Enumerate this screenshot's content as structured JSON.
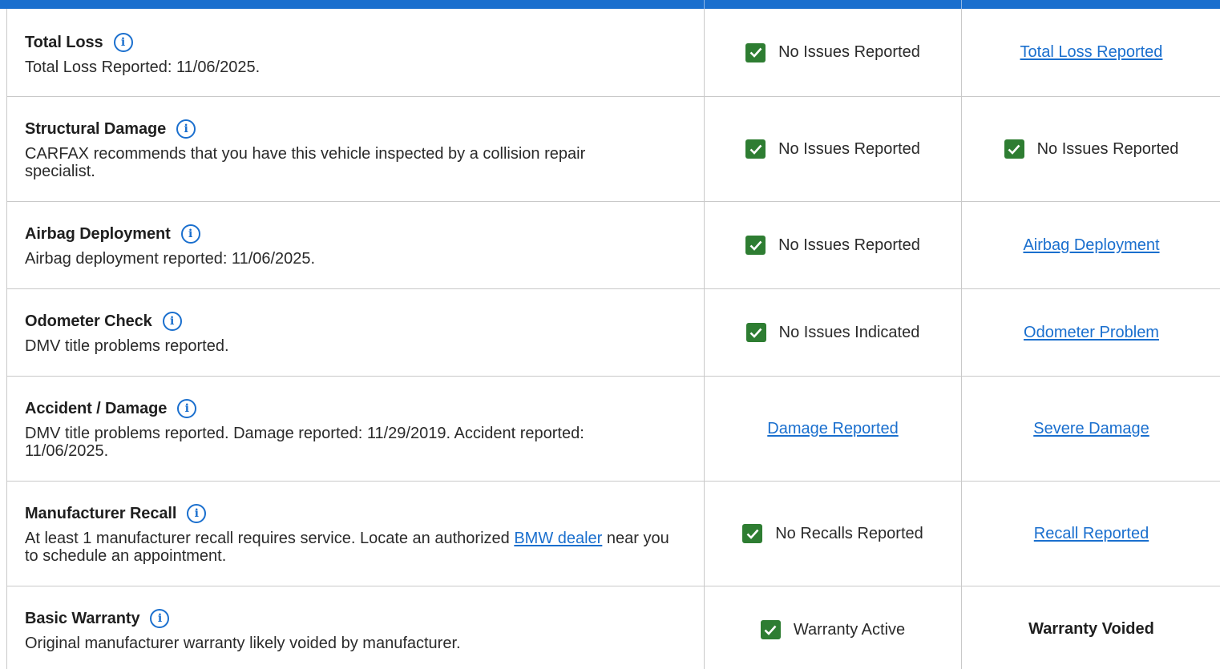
{
  "header": {
    "bar_color": "#1a6fce"
  },
  "rows": [
    {
      "title": "Total Loss",
      "desc": "Total Loss Reported: 11/06/2025.",
      "col2": {
        "kind": "check",
        "text": "No Issues Reported"
      },
      "col3": {
        "kind": "link",
        "text": "Total Loss Reported"
      }
    },
    {
      "title": "Structural Damage",
      "desc": "CARFAX recommends that you have this vehicle inspected by a collision repair specialist.",
      "col2": {
        "kind": "check",
        "text": "No Issues Reported"
      },
      "col3": {
        "kind": "check",
        "text": "No Issues Reported"
      }
    },
    {
      "title": "Airbag Deployment",
      "desc": "Airbag deployment reported: 11/06/2025.",
      "col2": {
        "kind": "check",
        "text": "No Issues Reported"
      },
      "col3": {
        "kind": "link",
        "text": "Airbag Deployment"
      }
    },
    {
      "title": "Odometer Check",
      "desc": "DMV title problems reported.",
      "col2": {
        "kind": "check",
        "text": "No Issues Indicated"
      },
      "col3": {
        "kind": "link",
        "text": "Odometer Problem"
      }
    },
    {
      "title": "Accident / Damage",
      "desc": "DMV title problems reported. Damage reported: 11/29/2019. Accident reported: 11/06/2025.",
      "col2": {
        "kind": "link",
        "text": "Damage Reported"
      },
      "col3": {
        "kind": "link",
        "text": "Severe Damage"
      }
    },
    {
      "title": "Manufacturer Recall",
      "desc_before": "At least 1 manufacturer recall requires service. Locate an authorized ",
      "desc_link": "BMW dealer",
      "desc_after": " near you to schedule an appointment.",
      "col2": {
        "kind": "check",
        "text": "No Recalls Reported"
      },
      "col3": {
        "kind": "link",
        "text": "Recall Reported"
      }
    },
    {
      "title": "Basic Warranty",
      "desc": "Original manufacturer warranty likely voided by manufacturer.",
      "col2": {
        "kind": "check",
        "text": "Warranty Active"
      },
      "col3": {
        "kind": "bold",
        "text": "Warranty Voided"
      }
    }
  ],
  "icons": {
    "info": "info-icon",
    "check": "checkmark-icon"
  },
  "colors": {
    "link": "#1a6fce",
    "check_bg": "#2e7d32",
    "border": "#c9c9c9"
  }
}
